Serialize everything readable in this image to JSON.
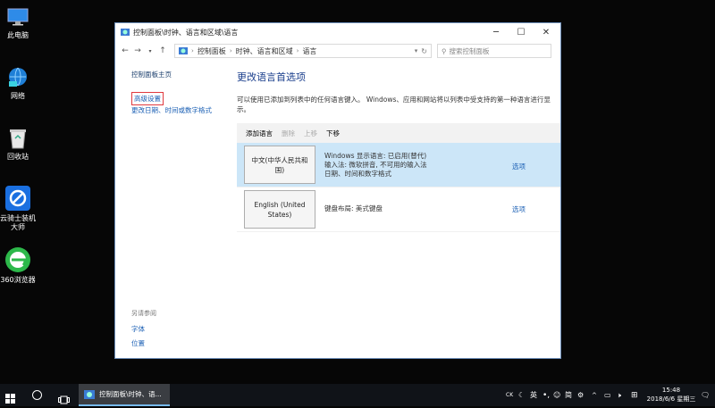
{
  "desktop": {
    "icons": [
      {
        "label": "此电脑",
        "icon": "computer-icon"
      },
      {
        "label": "网络",
        "icon": "network-icon"
      },
      {
        "label": "回收站",
        "icon": "recycle-bin-icon"
      },
      {
        "label": "云骑士装机大师",
        "icon": "yunqishi-icon"
      },
      {
        "label": "360浏览器",
        "icon": "360-browser-icon"
      }
    ]
  },
  "window": {
    "title": "控制面板\\时钟、语言和区域\\语言",
    "breadcrumb": [
      "控制面板",
      "时钟、语言和区域",
      "语言"
    ],
    "search_placeholder": "搜索控制面板",
    "left": {
      "home": "控制面板主页",
      "advanced": "高级设置",
      "change_datetime": "更改日期、时间或数字格式",
      "see_also_heading": "另请参阅",
      "see_also": [
        "字体",
        "位置"
      ]
    },
    "main": {
      "title": "更改语言首选项",
      "description": "可以使用已添加到列表中的任何语言键入。 Windows、应用和网站将以列表中受支持的第一种语言进行显示。",
      "toolbar": {
        "add": "添加语言",
        "remove": "删除",
        "up": "上移",
        "down": "下移"
      },
      "languages": [
        {
          "name": "中文(中华人民共和国)",
          "info": [
            "Windows 显示语言: 已启用(替代)",
            "输入法: 微软拼音, 不可用的输入法",
            "日期、时间和数字格式"
          ],
          "options": "选项"
        },
        {
          "name": "English (United States)",
          "info": [
            "键盘布局: 美式键盘"
          ],
          "options": "选项"
        }
      ]
    }
  },
  "taskbar": {
    "app_label": "控制面板\\时钟、语...",
    "tray": {
      "ime_ck": "CK",
      "ime_mode": "英",
      "ime_simp": "简"
    },
    "time": "15:48",
    "date": "2018/6/6 星期三"
  }
}
